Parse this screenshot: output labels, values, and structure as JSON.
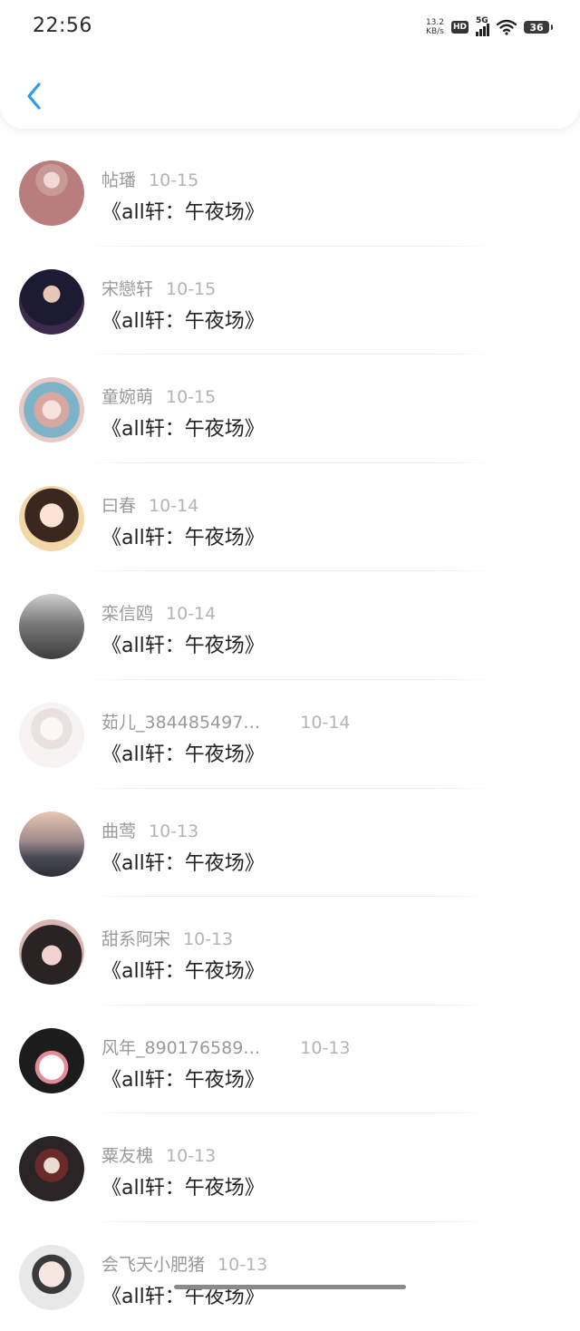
{
  "status_bar": {
    "time": "22:56",
    "net_speed_value": "13.2",
    "net_speed_unit": "KB/s",
    "hd_label": "HD",
    "network_label": "5G",
    "battery_level": "36"
  },
  "header": {
    "back_icon": "chevron-left-icon",
    "accent_color": "#2e9bf0"
  },
  "list": {
    "items": [
      {
        "user": "帖璠",
        "date": "10-15",
        "title": "《all轩：午夜场》"
      },
      {
        "user": "宋戀轩",
        "date": "10-15",
        "title": "《all轩：午夜场》"
      },
      {
        "user": "童婉萌",
        "date": "10-15",
        "title": "《all轩：午夜场》"
      },
      {
        "user": "曰春",
        "date": "10-14",
        "title": "《all轩：午夜场》"
      },
      {
        "user": "栾信鸥",
        "date": "10-14",
        "title": "《all轩：午夜场》"
      },
      {
        "user": "茹儿_384485497…",
        "date": "10-14",
        "title": "《all轩：午夜场》"
      },
      {
        "user": "曲莺",
        "date": "10-13",
        "title": "《all轩：午夜场》"
      },
      {
        "user": "甜系阿宋",
        "date": "10-13",
        "title": "《all轩：午夜场》"
      },
      {
        "user": "风年_890176589…",
        "date": "10-13",
        "title": "《all轩：午夜场》"
      },
      {
        "user": "粟友槐",
        "date": "10-13",
        "title": "《all轩：午夜场》"
      },
      {
        "user": "会飞天小肥猪",
        "date": "10-13",
        "title": "《all轩：午夜场》"
      }
    ]
  }
}
